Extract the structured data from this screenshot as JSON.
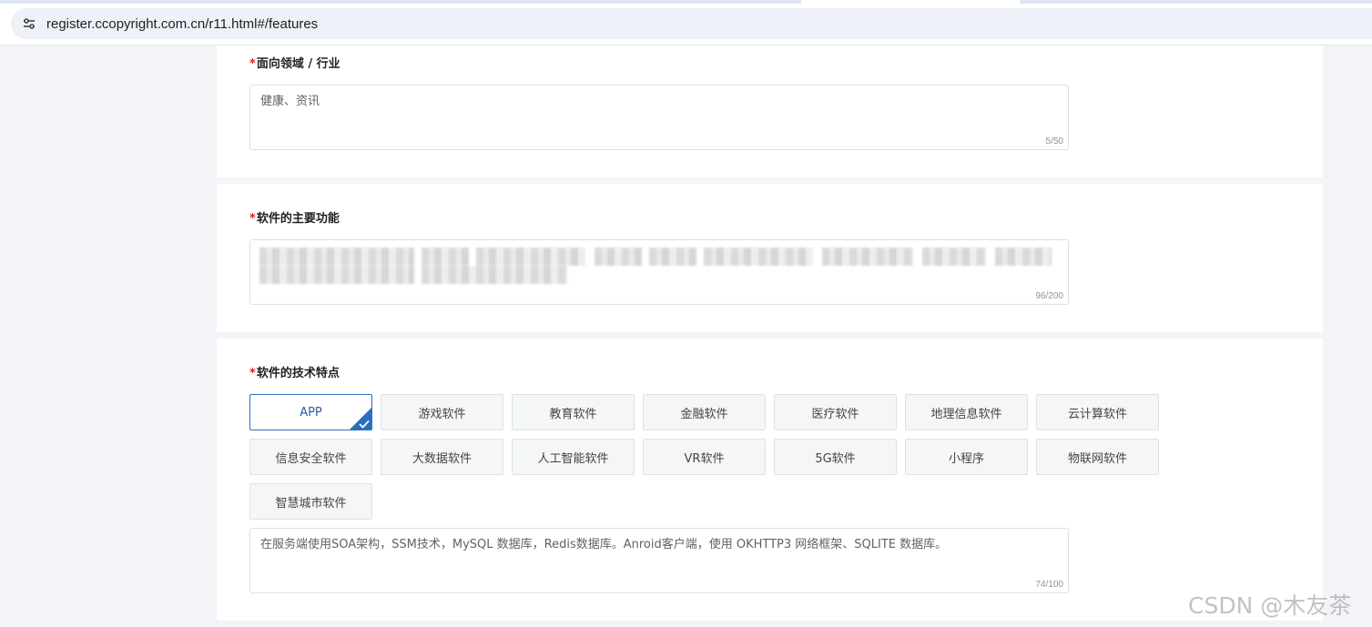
{
  "browser": {
    "url": "register.ccopyright.com.cn/r11.html#/features",
    "site_info_icon": "tune-icon"
  },
  "field_domain": {
    "required_mark": "*",
    "label": "面向领域 / 行业",
    "value": "健康、资讯",
    "counter": "5/50"
  },
  "field_functions": {
    "required_mark": "*",
    "label": "软件的主要功能",
    "value_blurred": true,
    "counter": "96/200"
  },
  "field_tech": {
    "required_mark": "*",
    "label": "软件的技术特点",
    "tags": [
      {
        "label": "APP",
        "selected": true
      },
      {
        "label": "游戏软件",
        "selected": false
      },
      {
        "label": "教育软件",
        "selected": false
      },
      {
        "label": "金融软件",
        "selected": false
      },
      {
        "label": "医疗软件",
        "selected": false
      },
      {
        "label": "地理信息软件",
        "selected": false
      },
      {
        "label": "云计算软件",
        "selected": false
      },
      {
        "label": "信息安全软件",
        "selected": false
      },
      {
        "label": "大数据软件",
        "selected": false
      },
      {
        "label": "人工智能软件",
        "selected": false
      },
      {
        "label": "VR软件",
        "selected": false
      },
      {
        "label": "5G软件",
        "selected": false
      },
      {
        "label": "小程序",
        "selected": false
      },
      {
        "label": "物联网软件",
        "selected": false
      },
      {
        "label": "智慧城市软件",
        "selected": false
      }
    ],
    "value": "在服务端使用SOA架构，SSM技术，MySQL 数据库，Redis数据库。Anroid客户端，使用 OKHTTP3 网络框架、SQLITE 数据库。",
    "counter": "74/100"
  },
  "watermark": "CSDN @木友茶",
  "colors": {
    "required": "#e02020",
    "selected_accent": "#2a6fbf",
    "page_bg": "#f2f4f7"
  }
}
